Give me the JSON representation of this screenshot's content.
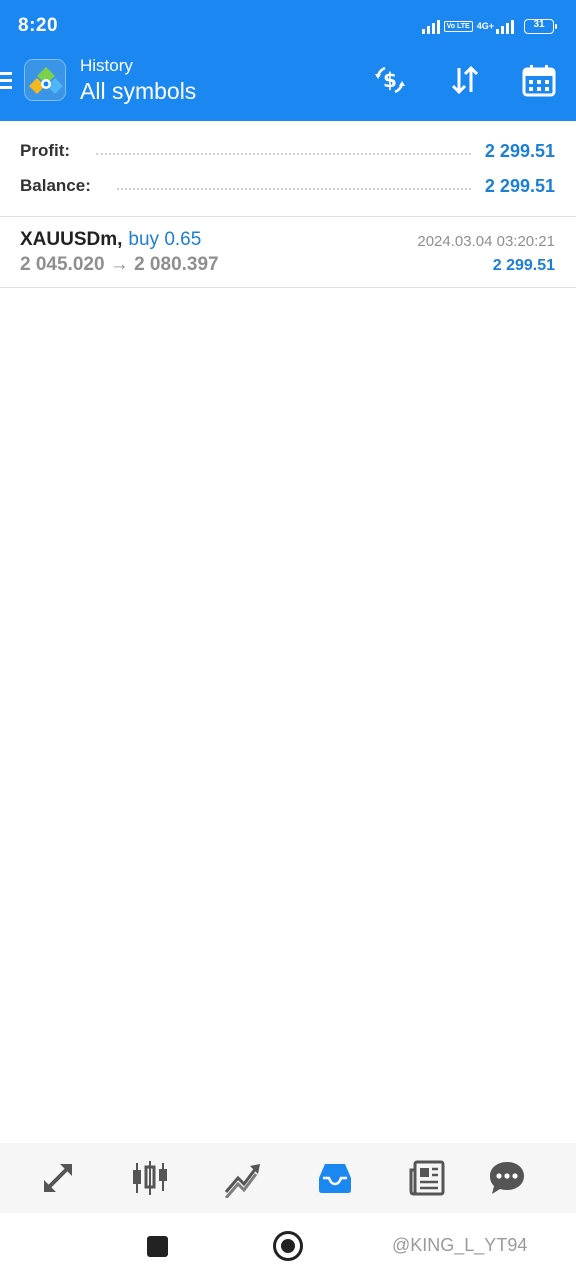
{
  "status_bar": {
    "time": "8:20",
    "network": "4G+",
    "volte": "Vo LTE",
    "battery": "31"
  },
  "app_bar": {
    "title": "History",
    "subtitle": "All symbols",
    "icons": [
      "menu-icon",
      "currency-exchange-icon",
      "sort-icon",
      "calendar-icon"
    ]
  },
  "summary": {
    "profit_label": "Profit:",
    "profit_value": "2 299.51",
    "balance_label": "Balance:",
    "balance_value": "2 299.51"
  },
  "deals": [
    {
      "symbol": "XAUUSDm",
      "type": "buy 0.65",
      "prices": "2 045.020 → 2 080.397",
      "time": "2024.03.04 03:20:21",
      "profit": "2 299.51"
    }
  ],
  "bottom_nav": {
    "active": "history",
    "items": [
      "quotes-icon",
      "chart-icon",
      "trade-icon",
      "history-icon",
      "news-icon",
      "chat-icon"
    ]
  },
  "watermark": "@KING_L_YT94",
  "colors": {
    "header": "#1b87f0",
    "accent": "#1b7fd6",
    "nav_inactive": "#555555",
    "nav_active": "#1b87f0"
  }
}
